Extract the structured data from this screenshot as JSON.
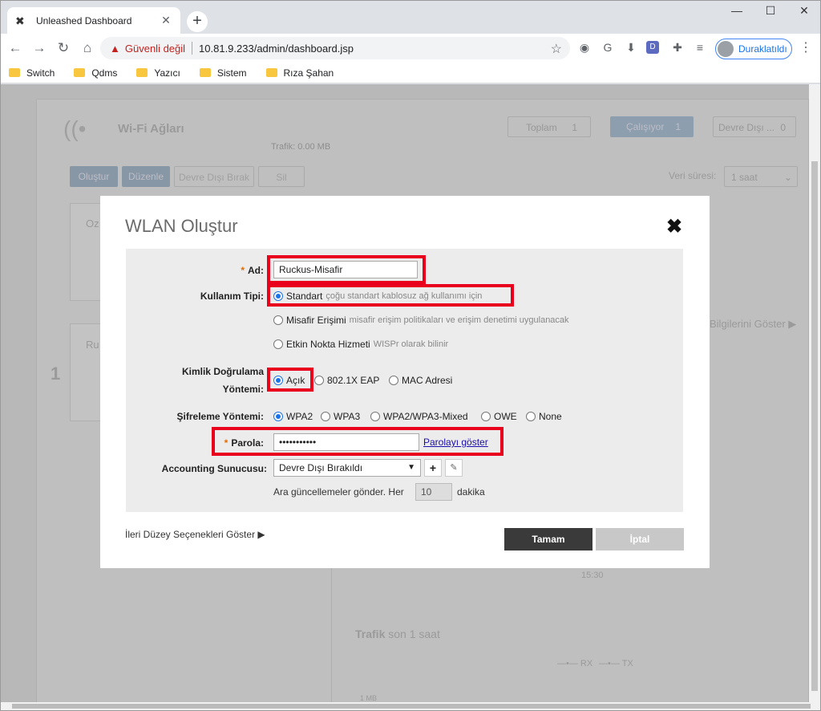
{
  "browser": {
    "tab_title": "Unleashed Dashboard",
    "security_label": "Güvenli değil",
    "url": "10.81.9.233/admin/dashboard.jsp",
    "profile_label": "Duraklatıldı",
    "bookmarks": [
      "Switch",
      "Qdms",
      "Yazıcı",
      "Sistem",
      "Rıza Şahan"
    ]
  },
  "background": {
    "section_title": "Wi-Fi Ağları",
    "traffic": "Trafik: 0.00 MB",
    "total_label": "Toplam",
    "total_value": "1",
    "running_label": "Çalışıyor",
    "running_value": "1",
    "disabled_label": "Devre Dışı ...",
    "disabled_value": "0",
    "btn_create": "Oluştur",
    "btn_edit": "Düzenle",
    "btn_disable": "Devre Dışı Bırak",
    "btn_delete": "Sil",
    "period_label": "Veri süresi:",
    "period_value": "1 saat",
    "card1_text": "Oz",
    "card2_text": "Ru",
    "big_number": "1",
    "info_link": "Bilgilerini Göster",
    "time_tick": "15:30",
    "traffic_title": "Trafik",
    "traffic_sub": "son 1 saat",
    "legend_rx": "RX",
    "legend_tx": "TX",
    "axis_label": "1 MB"
  },
  "modal": {
    "title": "WLAN Oluştur",
    "name_label": "Ad:",
    "name_value": "Ruckus-Misafir",
    "usage_label": "Kullanım Tipi:",
    "usage_options": [
      {
        "label": "Standart",
        "hint": "çoğu standart kablosuz ağ kullanımı için"
      },
      {
        "label": "Misafir Erişimi",
        "hint": "misafir erişim politikaları ve erişim denetimi uygulanacak"
      },
      {
        "label": "Etkin Nokta Hizmeti",
        "hint": "WISPr olarak bilinir"
      }
    ],
    "auth_label_1": "Kimlik Doğrulama",
    "auth_label_2": "Yöntemi:",
    "auth_options": [
      "Açık",
      "802.1X EAP",
      "MAC Adresi"
    ],
    "enc_label": "Şifreleme Yöntemi:",
    "enc_options": [
      "WPA2",
      "WPA3",
      "WPA2/WPA3-Mixed",
      "OWE",
      "None"
    ],
    "password_label": "Parola:",
    "password_value": "•••••••••••",
    "show_password": "Parolayı göster",
    "accounting_label": "Accounting Sunucusu:",
    "accounting_value": "Devre Dışı Bırakıldı",
    "interim_prefix": "Ara güncellemeler gönder. Her",
    "interim_value": "10",
    "interim_suffix": "dakika",
    "advanced": "İleri Düzey Seçenekleri Göster",
    "ok": "Tamam",
    "cancel": "İptal"
  }
}
